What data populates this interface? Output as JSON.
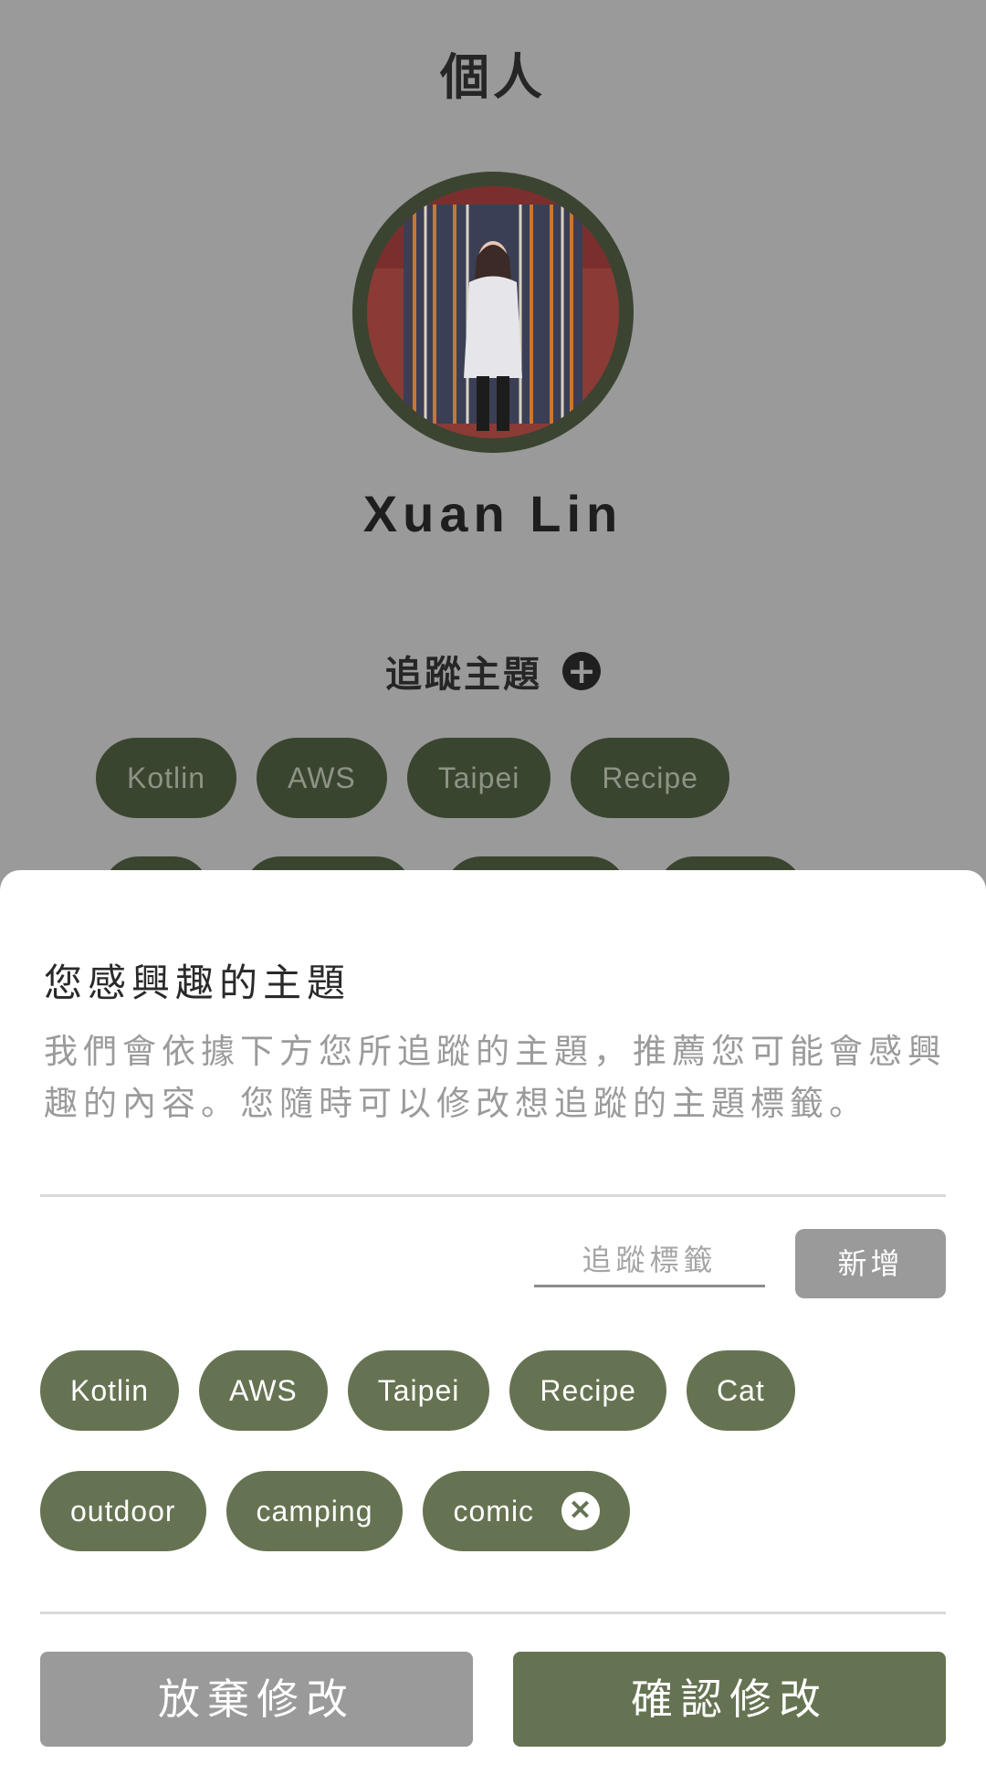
{
  "header": {
    "title": "個人"
  },
  "profile": {
    "name": "Xuan Lin"
  },
  "follow_section": {
    "title": "追蹤主題",
    "tags": [
      "Kotlin",
      "AWS",
      "Taipei",
      "Recipe"
    ]
  },
  "sheet": {
    "title": "您感興趣的主題",
    "description": "我們會依據下方您所追蹤的主題，推薦您可能會感興趣的內容。您隨時可以修改想追蹤的主題標籤。",
    "input_placeholder": "追蹤標籤",
    "add_label": "新增",
    "tags_row1": [
      "Kotlin",
      "AWS",
      "Taipei",
      "Recipe",
      "Cat"
    ],
    "tags_row2": [
      "outdoor",
      "camping",
      "comic"
    ],
    "cancel_label": "放棄修改",
    "confirm_label": "確認修改"
  },
  "colors": {
    "accent": "#667352",
    "dim_background": "#9a9a9a",
    "bg_tag": "#3a4530"
  },
  "icons": {
    "add": "plus-circle-icon",
    "remove": "close-circle-icon"
  }
}
